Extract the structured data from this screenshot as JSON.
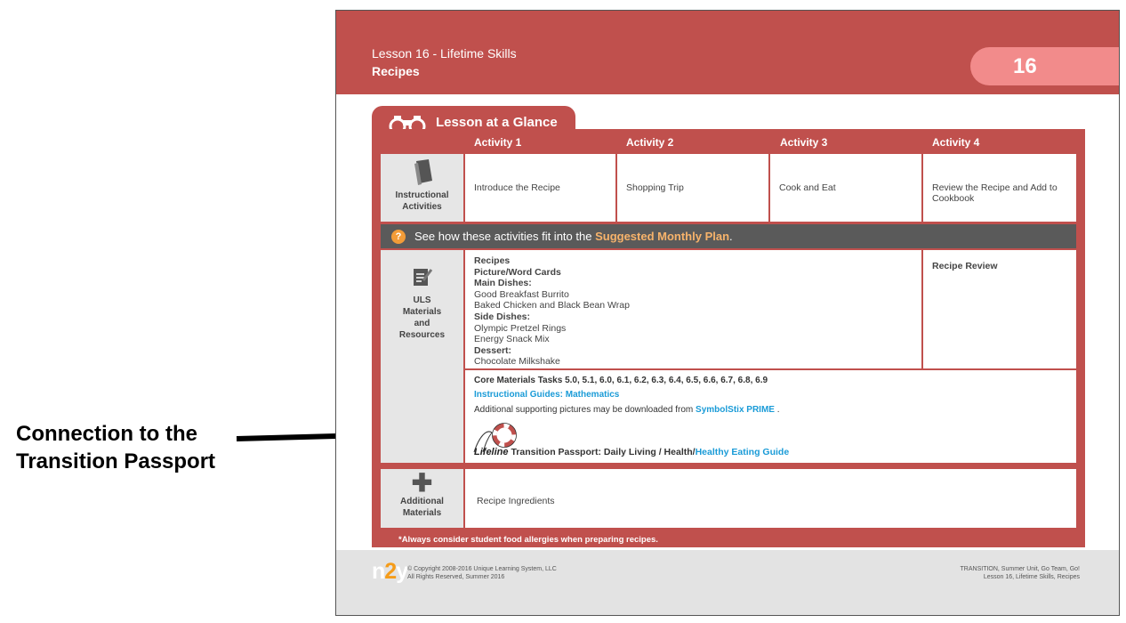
{
  "annotation": {
    "line1": "Connection to the",
    "line2": "Transition Passport"
  },
  "header": {
    "lesson_line": "Lesson 16 - Lifetime Skills",
    "title": "Recipes",
    "lesson_number": "16"
  },
  "glance": {
    "title": "Lesson at a Glance",
    "activities": [
      "Activity 1",
      "Activity 2",
      "Activity 3",
      "Activity 4"
    ],
    "instructional": {
      "label1": "Instructional",
      "label2": "Activities",
      "items": [
        "Introduce the Recipe",
        "Shopping Trip",
        "Cook and Eat",
        "Review the Recipe and Add to Cookbook"
      ]
    },
    "plan_bar": {
      "prefix": "See how these activities fit into the",
      "link": "Suggested Monthly Plan",
      "suffix": "."
    },
    "materials": {
      "label1": "ULS",
      "label2": "Materials",
      "label3": "and",
      "label4": "Resources",
      "h_recipes": "Recipes",
      "h_cards": "Picture/Word Cards",
      "h_main": "Main Dishes:",
      "main1": "Good Breakfast Burrito",
      "main2": "Baked Chicken and Black Bean Wrap",
      "h_side": "Side Dishes:",
      "side1": "Olympic Pretzel Rings",
      "side2": "Energy Snack Mix",
      "h_dessert": "Dessert:",
      "dessert1": "Chocolate Milkshake",
      "activity4": "Recipe Review"
    },
    "core": {
      "tasks_label": "Core Materials Tasks",
      "tasks": "5.0, 5.1, 6.0, 6.1, 6.2, 6.3, 6.4, 6.5, 6.6, 6.7, 6.8, 6.9",
      "guides": "Instructional Guides: Mathematics",
      "supporting_prefix": "Additional supporting pictures may be downloaded from",
      "supporting_link": "SymbolStix PRIME",
      "supporting_suffix": ".",
      "lifeline_logo": "Lifeline",
      "passport_prefix": "Transition Passport: Daily Living / Health/",
      "passport_link": "Healthy Eating Guide"
    },
    "additional": {
      "label1": "Additional",
      "label2": "Materials",
      "item": "Recipe Ingredients"
    },
    "footnote": "*Always consider student food allergies when preparing recipes."
  },
  "footer": {
    "logo_n": "n",
    "logo_2": "2",
    "logo_y": "y",
    "copy1": "© Copyright 2008-2016 Unique Learning System, LLC",
    "copy2": "All Rights Reserved, Summer 2016",
    "right1": "TRANSITION, Summer Unit, Go Team, Go!",
    "right2": "Lesson 16, Lifetime Skills, Recipes"
  },
  "colors": {
    "brand_red": "#c0504d",
    "badge_pink": "#f28b8b",
    "link_blue": "#1a9bd7",
    "link_orange": "#f7b36b"
  }
}
